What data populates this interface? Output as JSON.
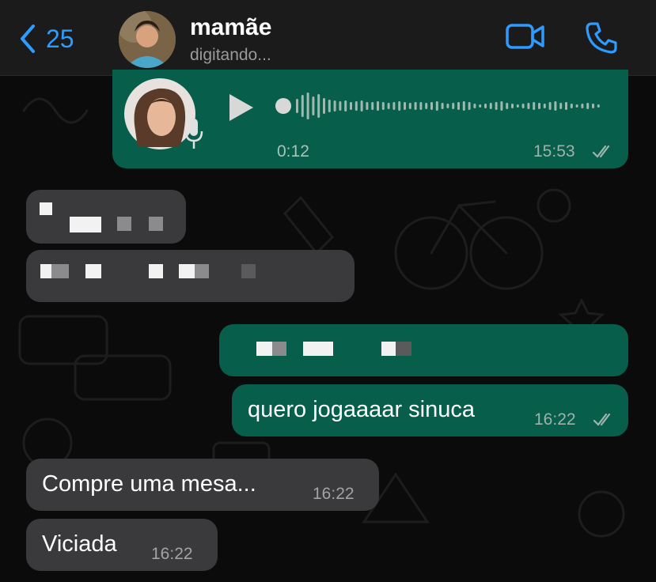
{
  "header": {
    "back_count": "25",
    "contact_name": "mamãe",
    "status": "digitando..."
  },
  "messages": [
    {
      "id": "voice",
      "direction": "out",
      "type": "voice",
      "duration": "0:12",
      "time": "15:53"
    },
    {
      "id": "in1",
      "direction": "in",
      "type": "redacted"
    },
    {
      "id": "in2",
      "direction": "in",
      "type": "redacted"
    },
    {
      "id": "out1",
      "direction": "out",
      "type": "redacted"
    },
    {
      "id": "out2",
      "direction": "out",
      "text": "quero jogaaaar sinuca",
      "time": "16:22"
    },
    {
      "id": "in3",
      "direction": "in",
      "text": "Compre uma mesa...",
      "time": "16:22"
    },
    {
      "id": "in4",
      "direction": "in",
      "text": "Viciada",
      "time": "16:22"
    }
  ],
  "colors": {
    "accent": "#2f9bff",
    "outgoing_bubble": "#075e4b",
    "incoming_bubble": "#3a3a3c",
    "background": "#0b0b0b"
  },
  "icons": [
    "chevron-left-icon",
    "video-call-icon",
    "phone-icon",
    "play-icon",
    "microphone-icon",
    "double-check-icon"
  ]
}
